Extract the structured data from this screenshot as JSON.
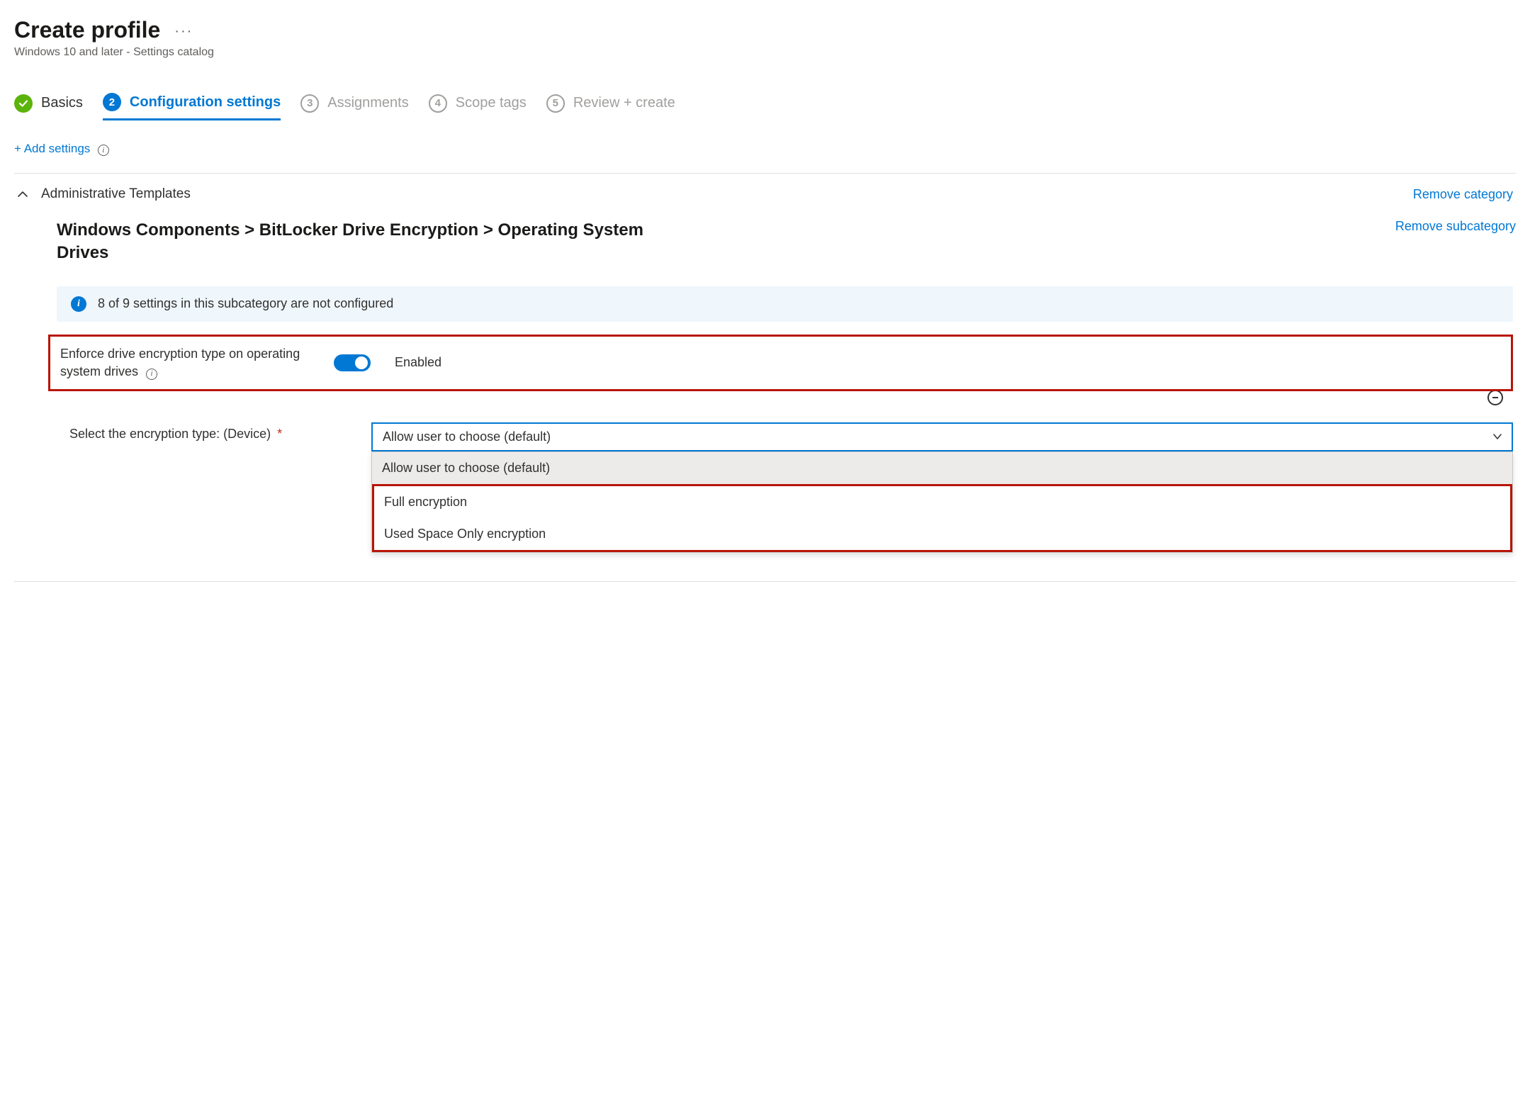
{
  "header": {
    "title": "Create profile",
    "subtitle": "Windows 10 and later - Settings catalog"
  },
  "wizard": {
    "steps": [
      {
        "num": "",
        "label": "Basics",
        "state": "done"
      },
      {
        "num": "2",
        "label": "Configuration settings",
        "state": "active"
      },
      {
        "num": "3",
        "label": "Assignments",
        "state": "pending"
      },
      {
        "num": "4",
        "label": "Scope tags",
        "state": "pending"
      },
      {
        "num": "5",
        "label": "Review + create",
        "state": "pending"
      }
    ]
  },
  "actions": {
    "add_settings": "+ Add settings"
  },
  "category": {
    "name": "Administrative Templates",
    "remove": "Remove category"
  },
  "subcategory": {
    "path": "Windows Components > BitLocker Drive Encryption > Operating System Drives",
    "remove": "Remove subcategory"
  },
  "banner": {
    "text": "8 of 9 settings in this subcategory are not configured"
  },
  "setting": {
    "label": "Enforce drive encryption type on operating system drives",
    "toggle_state": "Enabled"
  },
  "select": {
    "label": "Select the encryption type: (Device)",
    "selected": "Allow user to choose (default)",
    "options": [
      "Allow user to choose (default)",
      "Full encryption",
      "Used Space Only encryption"
    ]
  }
}
